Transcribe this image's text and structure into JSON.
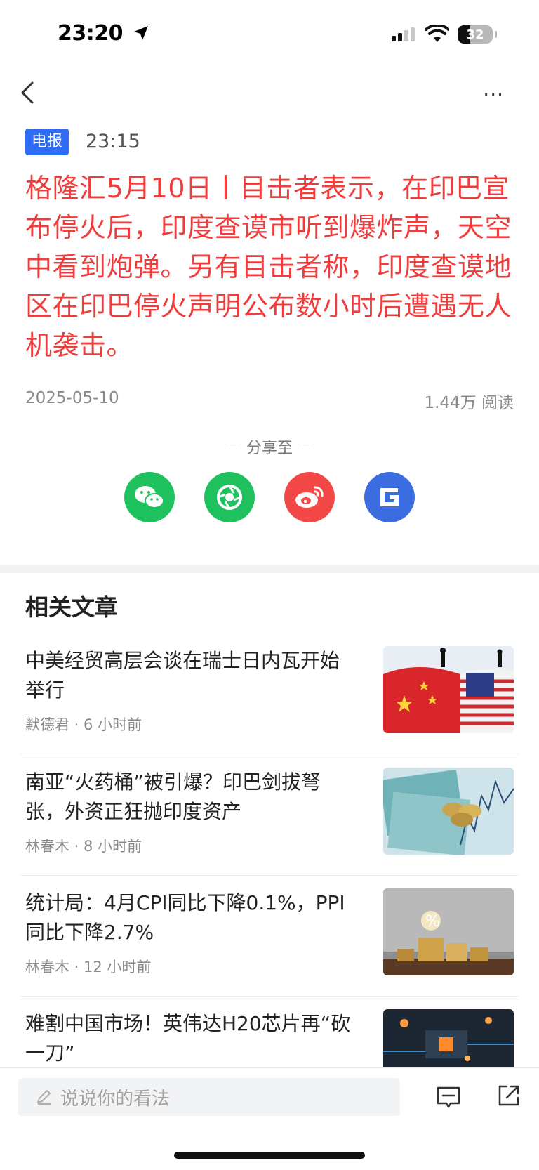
{
  "status_bar": {
    "time": "23:20",
    "battery": "32"
  },
  "header": {
    "more_label": "···"
  },
  "article": {
    "tag": "电报",
    "time": "23:15",
    "headline": "格隆汇5月10日丨目击者表示，在印巴宣布停火后，印度查谟市听到爆炸声，天空中看到炮弹。另有目击者称，印度查谟地区在印巴停火声明公布数小时后遭遇无人机袭击。",
    "date": "2025-05-10",
    "reads": "1.44万 阅读"
  },
  "share": {
    "label": "分享至",
    "targets": [
      "wechat",
      "moments",
      "weibo",
      "gelonghui"
    ]
  },
  "related": {
    "title": "相关文章",
    "items": [
      {
        "title": "中美经贸高层会谈在瑞士日内瓦开始举行",
        "author": "默德君",
        "ago": "6 小时前"
      },
      {
        "title": "南亚“火药桶”被引爆？印巴剑拔弩张，外资正狂抛印度资产",
        "author": "林春木",
        "ago": "8 小时前"
      },
      {
        "title": "统计局：4月CPI同比下降0.1%，PPI同比下降2.7%",
        "author": "林春木",
        "ago": "12 小时前"
      },
      {
        "title": "难割中国市场！英伟达H20芯片再“砍一刀”",
        "author": "",
        "ago": ""
      }
    ]
  },
  "bottom_bar": {
    "comment_placeholder": "说说你的看法"
  },
  "colors": {
    "headline": "#f23c3c",
    "tag": "#2f6cf6",
    "wechat": "#1fc15f",
    "weibo": "#f24848",
    "gelonghui": "#3b6de0"
  }
}
